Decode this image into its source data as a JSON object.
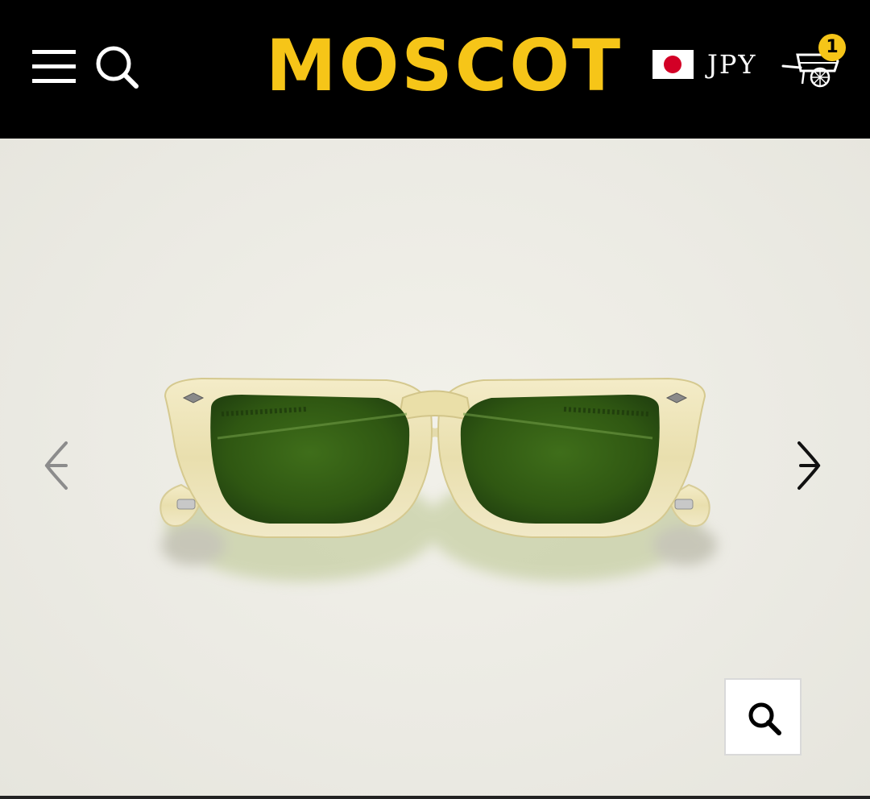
{
  "header": {
    "logo_text": "MOSCOT",
    "currency": "JPY",
    "cart_count": "1",
    "brand_color": "#f6c518",
    "background_color": "#000000",
    "icons": {
      "menu": "hamburger-menu-icon",
      "search": "search-icon",
      "flag": "japan-flag-icon",
      "cart": "pushcart-icon"
    }
  },
  "gallery": {
    "product_image": "sunglasses-flesh-frame-green-lens",
    "prev_icon": "chevron-left-icon",
    "next_icon": "chevron-right-icon",
    "zoom_icon": "magnifier-icon"
  }
}
